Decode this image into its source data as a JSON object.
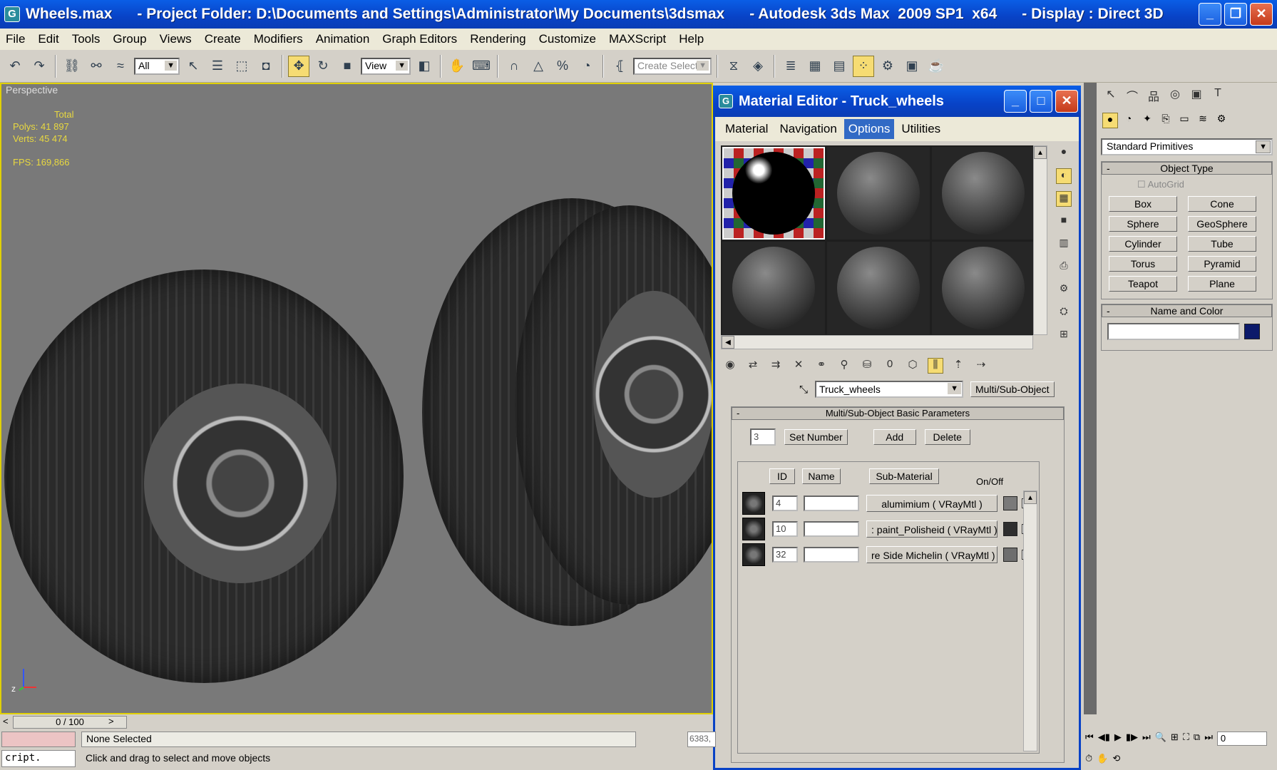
{
  "window": {
    "title": "Wheels.max      - Project Folder: D:\\Documents and Settings\\Administrator\\My Documents\\3dsmax      - Autodesk 3ds Max  2009 SP1  x64      - Display : Direct 3D"
  },
  "menubar": [
    "File",
    "Edit",
    "Tools",
    "Group",
    "Views",
    "Create",
    "Modifiers",
    "Animation",
    "Graph Editors",
    "Rendering",
    "Customize",
    "MAXScript",
    "Help"
  ],
  "toolbar": {
    "filter_value": "All",
    "coord_system": "View",
    "named_selection_placeholder": "Create Selecti"
  },
  "viewport": {
    "label": "Perspective",
    "stats_total": "Total",
    "stats_polys": "Polys: 41 897",
    "stats_verts": "Verts: 45 474",
    "stats_fps": "FPS:   169,866",
    "axis_label": "z"
  },
  "command_panel": {
    "category_dropdown": "Standard Primitives",
    "object_type_title": "Object Type",
    "autogrid_label": "AutoGrid",
    "objects": [
      "Box",
      "Cone",
      "Sphere",
      "GeoSphere",
      "Cylinder",
      "Tube",
      "Torus",
      "Pyramid",
      "Teapot",
      "Plane"
    ],
    "name_color_title": "Name and Color",
    "name_value": "",
    "object_color": "#0c1a6a"
  },
  "material_editor": {
    "title": "Material Editor - Truck_wheels",
    "menu": [
      "Material",
      "Navigation",
      "Options",
      "Utilities"
    ],
    "selected_menu": "Options",
    "material_name": "Truck_wheels",
    "material_type": "Multi/Sub-Object",
    "rollout_title": "Multi/Sub-Object Basic Parameters",
    "set_number_value": "3",
    "set_number_label": "Set Number",
    "add_label": "Add",
    "delete_label": "Delete",
    "col_id": "ID",
    "col_name": "Name",
    "col_submaterial": "Sub-Material",
    "col_onoff": "On/Off",
    "rows": [
      {
        "id": "4",
        "name": "",
        "submaterial": "alumimium  ( VRayMtl )",
        "color": "#7a7a7a",
        "on": true
      },
      {
        "id": "10",
        "name": "",
        "submaterial": ": paint_Polisheid  ( VRayMtl )",
        "color": "#2e2e2e",
        "on": true
      },
      {
        "id": "32",
        "name": "",
        "submaterial": "re Side Michelin  ( VRayMtl )",
        "color": "#6e6e6e",
        "on": true
      }
    ]
  },
  "statusbar": {
    "time_slider": "0 / 100",
    "selection_status": "None Selected",
    "prompt": "Click and drag to select and move objects",
    "script_text": "cript.",
    "coord_value": "6383,",
    "frame_value": "0"
  }
}
